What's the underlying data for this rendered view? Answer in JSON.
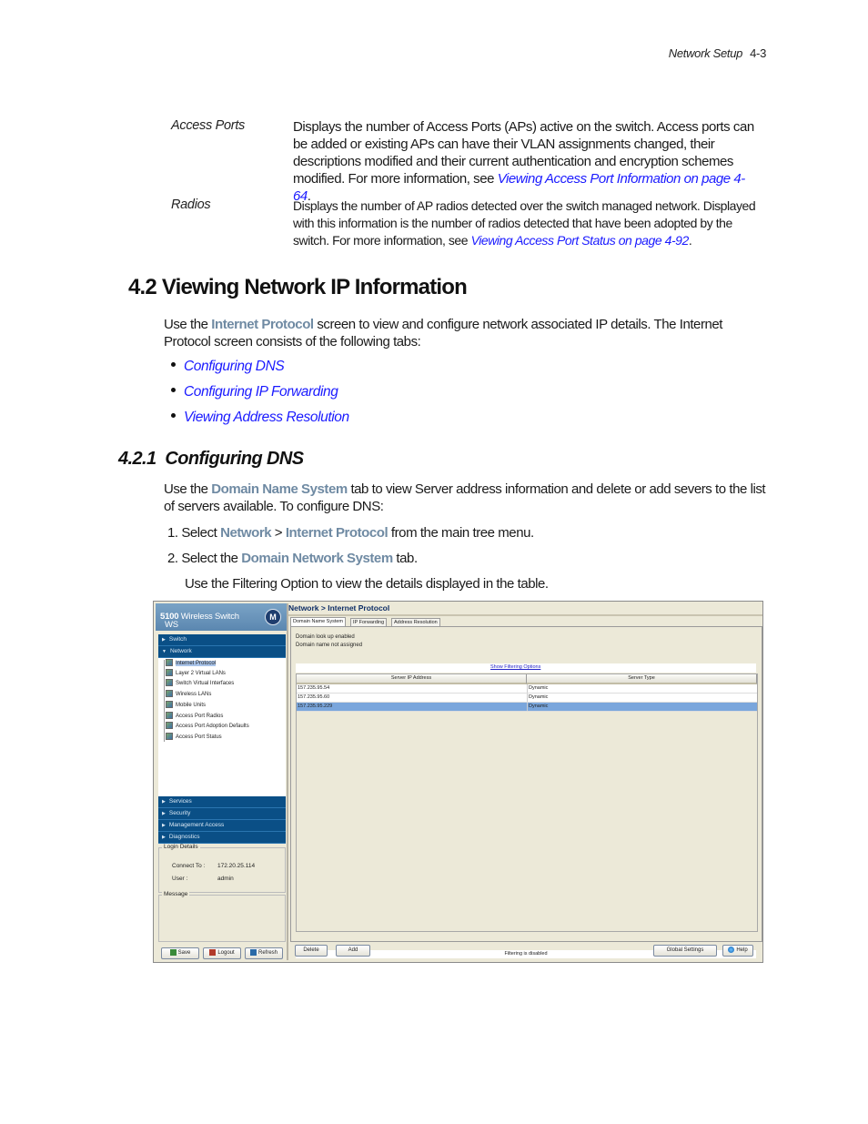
{
  "header": {
    "section": "Network Setup",
    "page": "4-3"
  },
  "definitions": [
    {
      "term": "Access Ports",
      "text": "Displays the number of Access Ports (APs) active on the switch. Access ports can be added or existing APs can have their VLAN assignments changed, their descriptions modified and their current authentication and encryption schemes modified. For more information, see ",
      "link": "Viewing Access Port Information on page 4-64",
      "tail": "."
    },
    {
      "term": "Radios",
      "text": "Displays the number of AP radios detected over the switch managed network. Displayed with this information is the number of radios detected that have been adopted by the switch. For more information, see ",
      "link": "Viewing Access Port Status on page 4-92",
      "tail": "."
    }
  ],
  "section": {
    "title": "4.2 Viewing Network IP Information",
    "intro_pre": "Use the ",
    "intro_ui": "Internet Protocol",
    "intro_post": " screen to view and configure network associated IP details. The Internet Protocol screen consists of the following tabs:",
    "bullets": [
      "Configuring DNS",
      "Configuring IP Forwarding",
      "Viewing Address Resolution"
    ]
  },
  "subsection": {
    "title": "4.2.1  Configuring DNS",
    "intro_pre": "Use the ",
    "intro_ui": "Domain Name System",
    "intro_post": " tab to view Server address information and delete or add severs to the list of servers available. To configure DNS:",
    "steps": [
      {
        "num": "1.",
        "pre": "Select ",
        "ui1": "Network",
        "sep": " > ",
        "ui2": "Internet Protocol",
        "post": " from the main tree menu."
      },
      {
        "num": "2.",
        "pre": "Select the ",
        "ui1": "Domain Network System",
        "post": " tab."
      }
    ],
    "note": "Use the Filtering Option to view the details displayed in the table."
  },
  "screenshot": {
    "brand_prefix": "WS",
    "brand_model": "5100",
    "brand_suffix": " Wireless Switch",
    "logo": "M",
    "nav_top": [
      {
        "label": "Switch",
        "expanded": false
      },
      {
        "label": "Network",
        "expanded": true
      }
    ],
    "tree": [
      {
        "label": "Internet Protocol",
        "selected": true
      },
      {
        "label": "Layer 2 Virtual LANs"
      },
      {
        "label": "Switch Virtual Interfaces"
      },
      {
        "label": "Wireless LANs"
      },
      {
        "label": "Mobile Units"
      },
      {
        "label": "Access Port Radios"
      },
      {
        "label": "Access Port Adoption Defaults"
      },
      {
        "label": "Access Port Status"
      }
    ],
    "nav_bottom": [
      {
        "label": "Services"
      },
      {
        "label": "Security"
      },
      {
        "label": "Management Access"
      },
      {
        "label": "Diagnostics"
      }
    ],
    "login": {
      "legend": "Login Details",
      "connect_label": "Connect To :",
      "connect_value": "172.20.25.114",
      "user_label": "User :",
      "user_value": "admin"
    },
    "message_legend": "Message",
    "left_buttons": {
      "save": "Save",
      "logout": "Logout",
      "refresh": "Refresh"
    },
    "title": "Network > Internet Protocol",
    "tabs": [
      "Domain Name System",
      "IP Forwarding",
      "Address Resolution"
    ],
    "status_lines": [
      "Domain look up enabled",
      "Domain name not assigned"
    ],
    "filter_link": "Show Filtering Options",
    "columns": [
      "Server IP Address",
      "Server Type"
    ],
    "rows": [
      {
        "ip": "157.235.95.54",
        "type": "Dynamic",
        "selected": false
      },
      {
        "ip": "157.235.95.60",
        "type": "Dynamic",
        "selected": false
      },
      {
        "ip": "157.235.95.229",
        "type": "Dynamic",
        "selected": true
      }
    ],
    "filter_status": "Filtering is disabled",
    "buttons": {
      "delete": "Delete",
      "add": "Add",
      "global": "Global Settings",
      "help": "Help"
    }
  }
}
